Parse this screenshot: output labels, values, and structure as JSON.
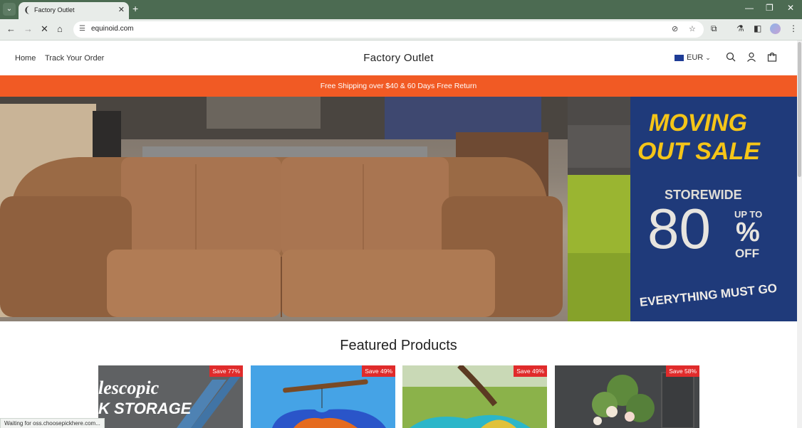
{
  "browser": {
    "tab_title": "Factory Outlet",
    "url": "equinoid.com",
    "status_text": "Waiting for oss.choosepickhere.com..."
  },
  "header": {
    "nav": [
      "Home",
      "Track Your Order"
    ],
    "site_title": "Factory Outlet",
    "currency": "EUR"
  },
  "banner": {
    "text": "Free Shipping over $40 & 60 Days Free Return"
  },
  "hero": {
    "sign_line1": "MOVING",
    "sign_line2": "OUT SALE",
    "storewide": "STOREWIDE",
    "percent": "80",
    "up_to": "UP TO",
    "percent_sign": "%",
    "off": "OFF",
    "everything": "EVERYTHING MUST GO"
  },
  "featured": {
    "title": "Featured Products",
    "products": [
      {
        "badge": "Save 77%",
        "image_text": "lescopic\nK STORAGE"
      },
      {
        "badge": "Save 49%"
      },
      {
        "badge": "Save 49%"
      },
      {
        "badge": "Save 58%"
      }
    ]
  },
  "colors": {
    "tab_bar": "#4c6b52",
    "banner": "#f15a24",
    "badge": "#e02b2b",
    "sign_blue": "#1f3a7a",
    "sign_yellow": "#f5c518"
  }
}
